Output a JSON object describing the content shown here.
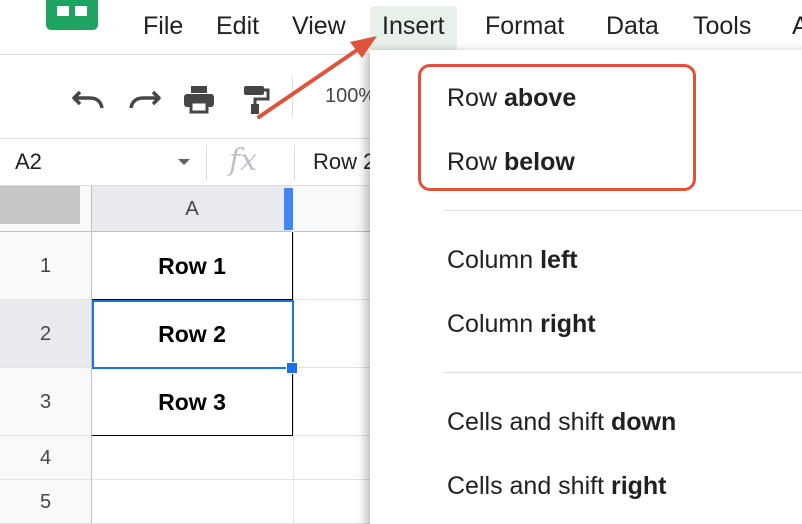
{
  "menu_bar": {
    "items": [
      {
        "label": "File"
      },
      {
        "label": "Edit"
      },
      {
        "label": "View"
      },
      {
        "label": "Insert",
        "active": true
      },
      {
        "label": "Format"
      },
      {
        "label": "Data"
      },
      {
        "label": "Tools"
      },
      {
        "label": "A"
      }
    ]
  },
  "toolbar": {
    "icons": [
      "undo-icon",
      "redo-icon",
      "print-icon",
      "paint-format-icon"
    ],
    "zoom": "100%"
  },
  "formula_bar": {
    "name_box": "A2",
    "fx_label": "fx",
    "value": "Row 2"
  },
  "grid": {
    "column_headers": [
      "A"
    ],
    "rows": [
      {
        "number": "1",
        "a": "Row 1"
      },
      {
        "number": "2",
        "a": "Row 2",
        "selected": true
      },
      {
        "number": "3",
        "a": "Row 3"
      },
      {
        "number": "4",
        "a": ""
      },
      {
        "number": "5",
        "a": ""
      }
    ]
  },
  "insert_menu": {
    "options": [
      {
        "prefix": "Row ",
        "bold": "above"
      },
      {
        "prefix": "Row ",
        "bold": "below"
      },
      {
        "prefix": "Column ",
        "bold": "left"
      },
      {
        "prefix": "Column ",
        "bold": "right"
      },
      {
        "prefix": "Cells and shift ",
        "bold": "down"
      },
      {
        "prefix": "Cells and shift ",
        "bold": "right"
      }
    ]
  },
  "colors": {
    "brand": "#1ea362",
    "selection": "#1a73e8",
    "annotation": "#e0523a",
    "menu_active_bg": "#e8f0ea"
  }
}
